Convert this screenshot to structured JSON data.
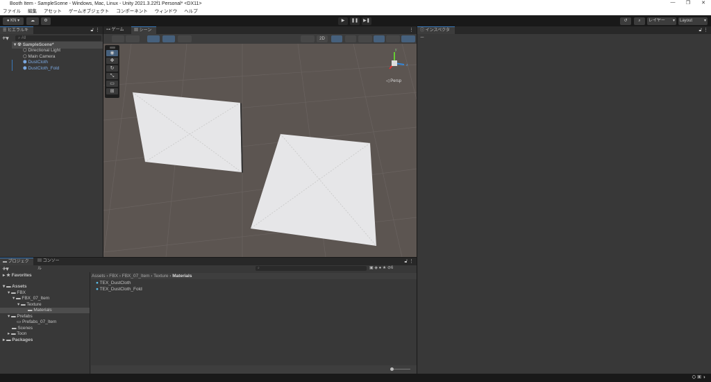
{
  "window": {
    "title": "Booth Item - SampleScene - Windows, Mac, Linux - Unity 2021.3.22f1 Personal* <DX11>",
    "controls": [
      "—",
      "❐",
      "✕"
    ]
  },
  "menu": [
    "ファイル",
    "編集",
    "アセット",
    "ゲームオブジェクト",
    "コンポーネント",
    "ウィンドウ",
    "ヘルプ"
  ],
  "toolbar": {
    "account": "KN",
    "layers": "レイヤー",
    "layout": "Layout",
    "play": "▶",
    "pause": "❚❚",
    "step": "▶❚"
  },
  "hierarchy": {
    "tab": "ヒエラルキー",
    "search_placeholder": "All",
    "scene": "SampleScene*",
    "items": [
      {
        "label": "Directional Light"
      },
      {
        "label": "Main Camera"
      },
      {
        "label": "DustCloth"
      },
      {
        "label": "DustCloth_Fold"
      }
    ]
  },
  "scene": {
    "tabs": [
      "ゲーム",
      "シーン"
    ],
    "mode_2d": "2D",
    "persp": "Persp",
    "gizmo_axes": {
      "y": "y",
      "z": "z",
      "x": "x"
    }
  },
  "inspector": {
    "tab": "インスペクター"
  },
  "project": {
    "tabs": [
      "プロジェクト",
      "コンソール"
    ],
    "favorites": "Favorites",
    "assets": "Assets",
    "tree": [
      {
        "label": "FBX"
      },
      {
        "label": "FBX_07_Item"
      },
      {
        "label": "Texture"
      },
      {
        "label": "Materials"
      },
      {
        "label": "Prefabs"
      },
      {
        "label": "Prefabs_07_Item"
      },
      {
        "label": "Scenes"
      },
      {
        "label": "Toon"
      }
    ],
    "packages": "Packages",
    "breadcrumb": [
      "Assets",
      "FBX",
      "FBX_07_Item",
      "Texture",
      "Materials"
    ],
    "files": [
      {
        "label": "TEX_DustCloth"
      },
      {
        "label": "TEX_DustCloth_Fold"
      }
    ],
    "hidden_count": "6"
  }
}
